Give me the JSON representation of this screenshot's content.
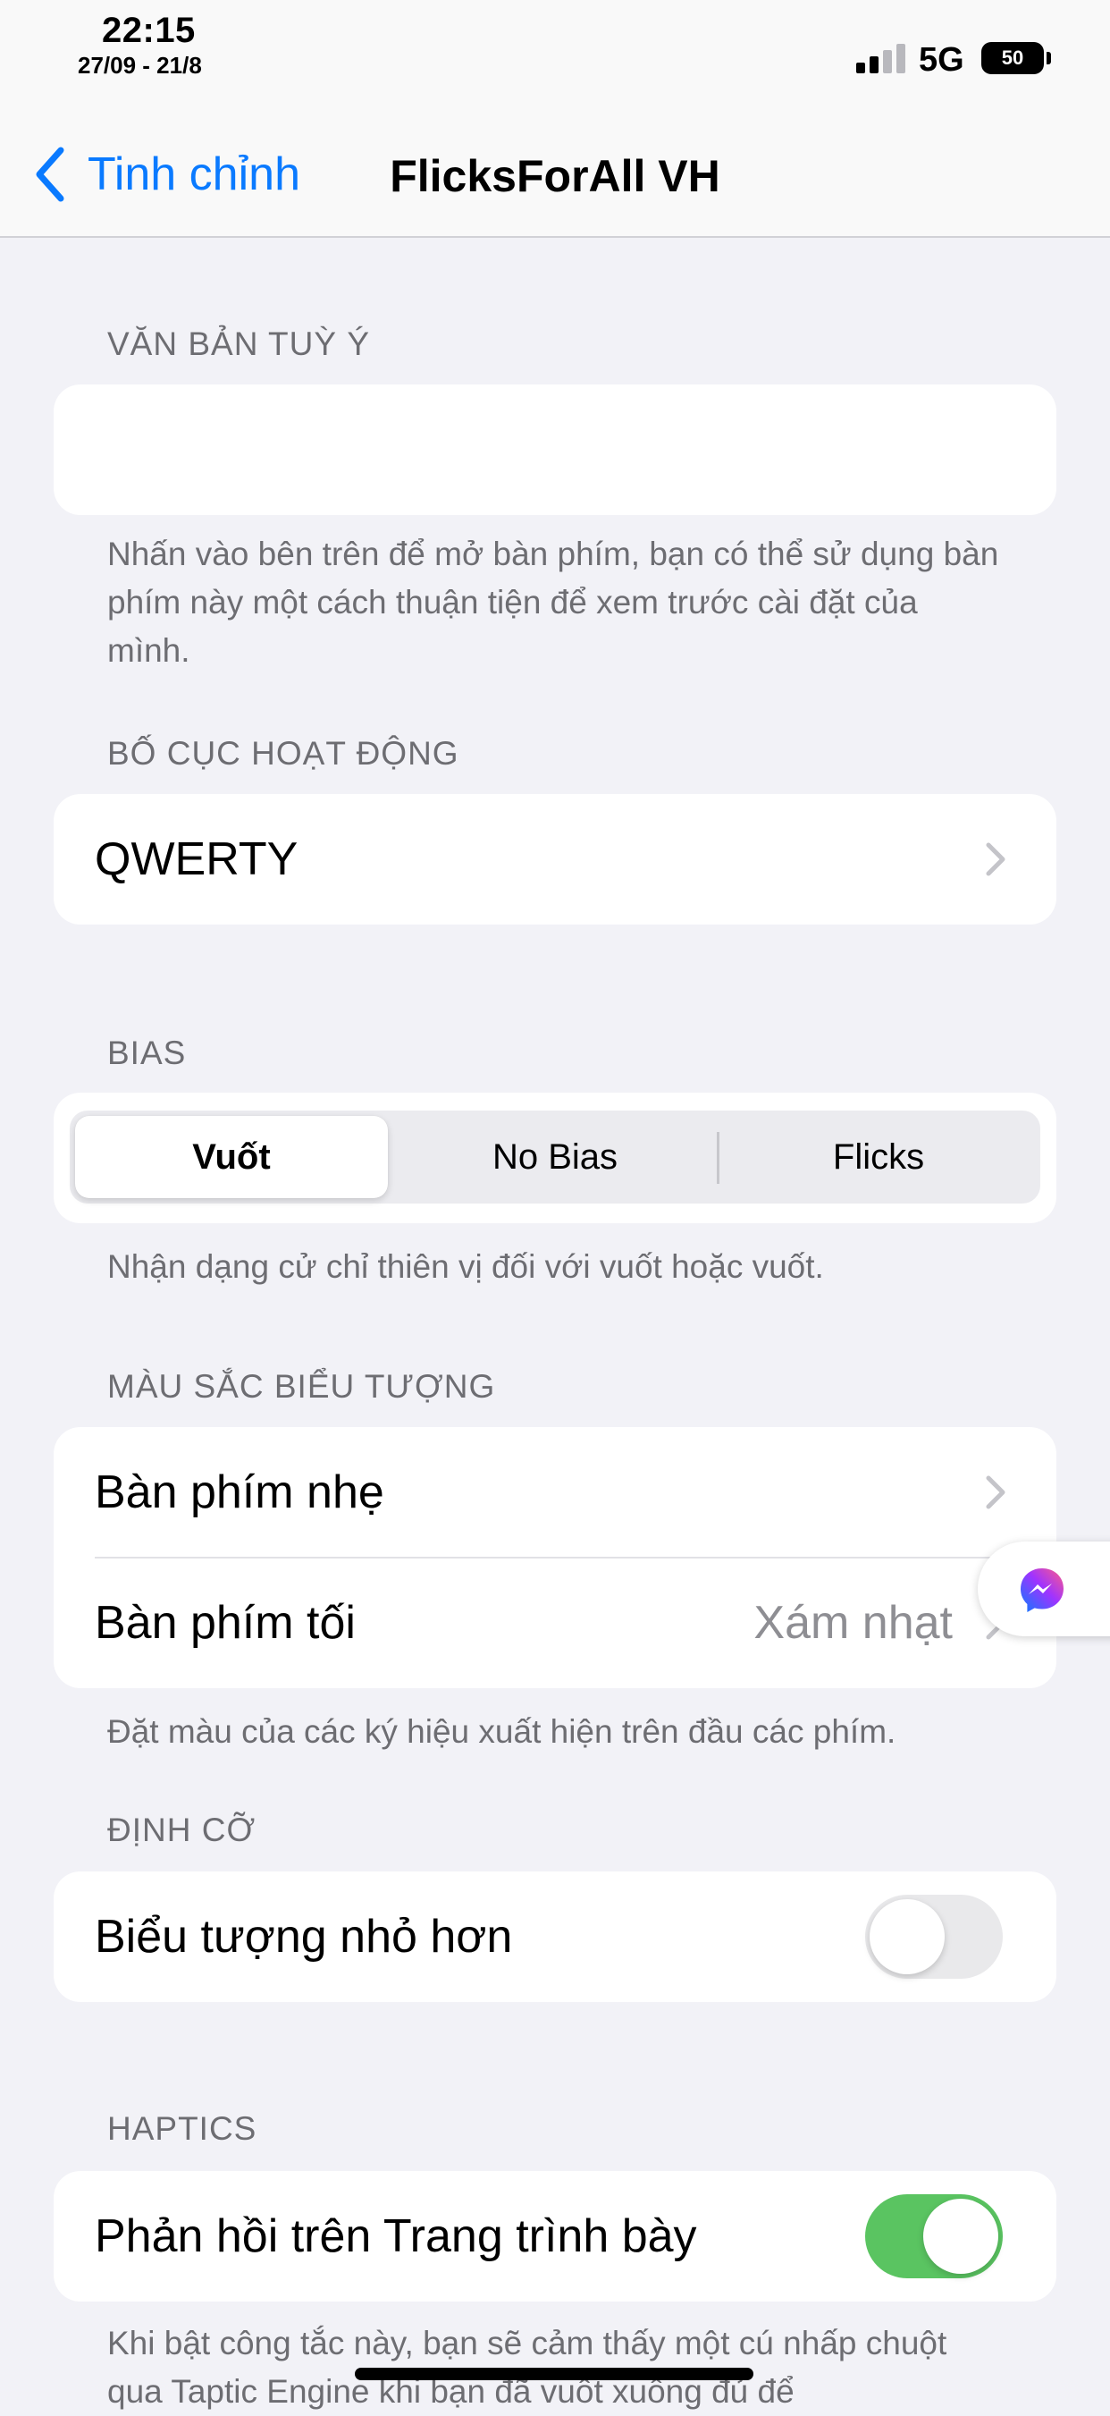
{
  "status_bar": {
    "time": "22:15",
    "date": "27/09 - 21/8",
    "network": "5G",
    "battery": "50"
  },
  "nav": {
    "back_label": "Tinh chỉnh",
    "title": "FlicksForAll VH"
  },
  "sections": {
    "custom_text": {
      "header": "VĂN BẢN TUỲ Ý",
      "input_value": "",
      "footer": "Nhấn vào bên trên để mở bàn phím, bạn có thể sử dụng bàn phím này một cách thuận tiện để xem trước cài đặt của mình."
    },
    "active_layout": {
      "header": "BỐ CỤC HOẠT ĐỘNG",
      "value": "QWERTY"
    },
    "bias": {
      "header": "BIAS",
      "options": [
        "Vuốt",
        "No Bias",
        "Flicks"
      ],
      "selected": "Vuốt",
      "footer": "Nhận dạng cử chỉ thiên vị đối với vuốt hoặc vuốt."
    },
    "icon_color": {
      "header": "MÀU SẮC BIỂU TƯỢNG",
      "rows": [
        {
          "label": "Bàn phím nhẹ",
          "value": ""
        },
        {
          "label": "Bàn phím tối",
          "value": "Xám nhạt"
        }
      ],
      "footer": "Đặt màu của các ký hiệu xuất hiện trên đầu các phím."
    },
    "sizing": {
      "header": "ĐỊNH CỠ",
      "label": "Biểu tượng nhỏ hơn",
      "enabled": false
    },
    "haptics": {
      "header": "HAPTICS",
      "label": "Phản hồi trên Trang trình bày",
      "enabled": true,
      "footer": "Khi bật công tắc này, bạn sẽ cảm thấy một cú nhấp chuột qua Taptic Engine khi bạn đã vuốt xuống đủ để"
    }
  },
  "colors": {
    "accent": "#0a7aff",
    "toggle_on": "#5ac461",
    "toggle_off": "#e9e9eb",
    "background": "#f2f2f7"
  },
  "icons": {
    "back": "chevron-left-icon",
    "row_chevron": "chevron-right-icon",
    "floating": "messenger-icon"
  }
}
